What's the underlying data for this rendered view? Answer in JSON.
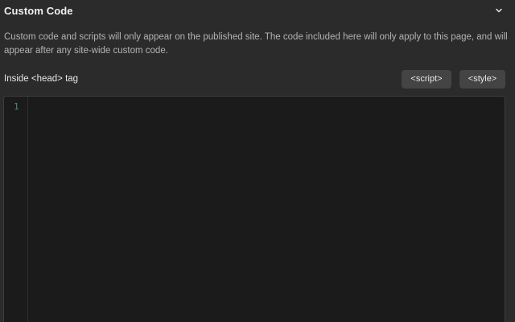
{
  "section": {
    "title": "Custom Code",
    "toggle_icon": "chevron-down-icon"
  },
  "description": "Custom code and scripts will only appear on the published site. The code included here will only apply to this page, and will appear after any site-wide custom code.",
  "head_code": {
    "label": "Inside <head> tag",
    "buttons": {
      "script": "<script>",
      "style": "<style>"
    },
    "editor": {
      "line_numbers": [
        "1"
      ],
      "content": ""
    }
  },
  "colors": {
    "panel_bg": "#2b2b2b",
    "editor_bg": "#1b1b1b",
    "button_bg": "#444444",
    "line_number": "#4a8a7e"
  }
}
